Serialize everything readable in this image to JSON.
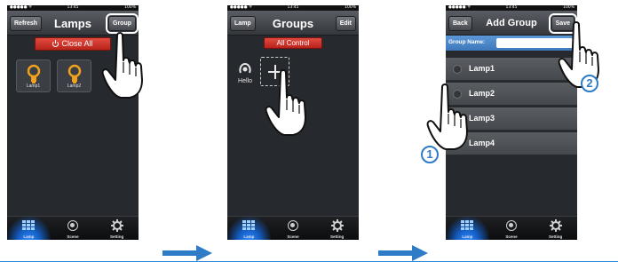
{
  "status_bar": {
    "signal": "●●●●● ᯤ",
    "time": "13:45",
    "battery": "100%"
  },
  "screen1": {
    "title": "Lamps",
    "left_button": "Refresh",
    "right_button": "Group",
    "close_all_label": "Close All",
    "lamps": [
      {
        "label": "Lamp1"
      },
      {
        "label": "Lamp2"
      }
    ]
  },
  "screen2": {
    "title": "Groups",
    "left_button": "Lamp",
    "right_button": "Edit",
    "all_control_label": "All Control",
    "groups": [
      {
        "label": "Hello"
      }
    ]
  },
  "screen3": {
    "title": "Add Group",
    "left_button": "Back",
    "right_button": "Save",
    "group_name_label": "Group Name:",
    "group_name_value": "",
    "lamps": [
      {
        "label": "Lamp1"
      },
      {
        "label": "Lamp2"
      },
      {
        "label": "Lamp3"
      },
      {
        "label": "Lamp4"
      }
    ]
  },
  "tabbar": {
    "tabs": [
      {
        "label": "Lamp",
        "icon": "grid-icon"
      },
      {
        "label": "Scene",
        "icon": "scene-icon"
      },
      {
        "label": "Setting",
        "icon": "gear-icon"
      }
    ]
  },
  "annotations": {
    "step1": "1",
    "step2": "2"
  },
  "colors": {
    "accent_blue": "#2e7cc7",
    "red_button": "#c8302a",
    "background": "#26292e"
  }
}
